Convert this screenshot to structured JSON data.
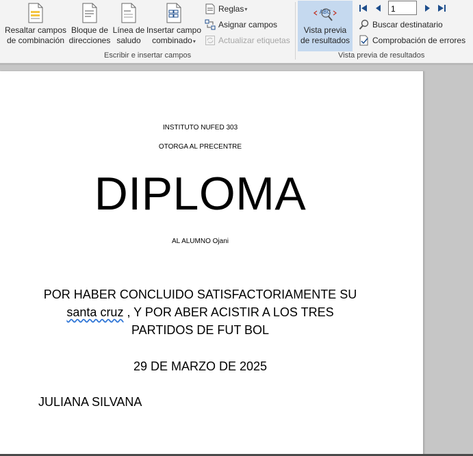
{
  "ribbon": {
    "write_group": {
      "label": "Escribir e insertar campos",
      "highlight": {
        "line1": "Resaltar campos",
        "line2": "de combinación"
      },
      "address": {
        "line1": "Bloque de",
        "line2": "direcciones"
      },
      "greeting": {
        "line1": "Línea de",
        "line2": "saludo"
      },
      "insert_field": {
        "line1": "Insertar campo",
        "line2": "combinado"
      },
      "rules": "Reglas",
      "match_fields": "Asignar campos",
      "update_labels": "Actualizar etiquetas"
    },
    "preview_group": {
      "label": "Vista previa de resultados",
      "preview": {
        "line1": "Vista previa",
        "line2": "de resultados"
      },
      "record": "1",
      "find_recipient": "Buscar destinatario",
      "check_errors": "Comprobación de errores"
    }
  },
  "document": {
    "institute": "INSTITUTO NUFED 303",
    "grants": "OTORGA AL PRECENTRE",
    "title": "DIPLOMA",
    "student_prefix": "AL ALUMNO ",
    "student_name": "Ojani",
    "body_line1": "POR HABER CONCLUIDO SATISFACTORIAMENTE  SU",
    "body_line2_a": "santa cruz",
    "body_line2_b": " , Y POR ABER  ACISTIR A LOS TRES",
    "body_line3": "PARTIDOS DE FUT BOL",
    "date": "29 DE MARZO DE 2025",
    "signer": "JULIANA SILVANA"
  },
  "colors": {
    "ribbon_bg": "#f3f3f3",
    "selected_button": "#c5d9ef",
    "nav_blue": "#1e4e8c",
    "canvas_bg": "#c6c6c6"
  }
}
